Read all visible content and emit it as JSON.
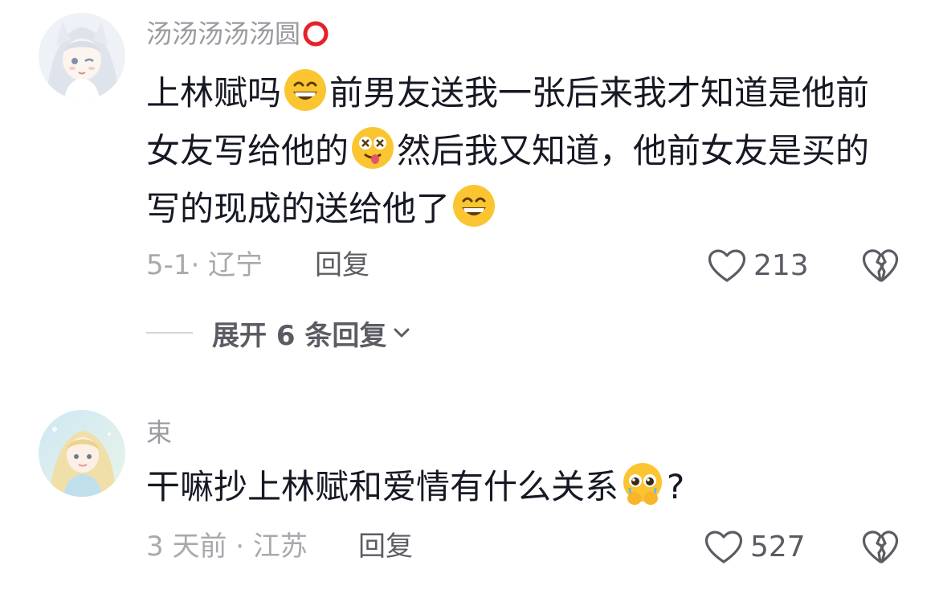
{
  "comments": [
    {
      "username": "汤汤汤汤汤圆",
      "username_emoji": "red-circle-icon",
      "text_segments": [
        "上林赋吗",
        "[grin]",
        "前男友送我一张后来我才知道是他前女友写给他的",
        "[dizzy]",
        "然后我又知道，他前女友是买的写的现成的送给他了",
        "[grin]"
      ],
      "text_1": "上林赋吗",
      "text_2": "前男友送我一张后来我才知道是他前女友写给他的",
      "text_3": "然后我又知道，他前女友是买的写的现成的送给他了",
      "date": "5-1",
      "location": "辽宁",
      "meta": "5-1· 辽宁",
      "reply_label": "回复",
      "like_count": "213",
      "expand_label": "展开 6 条回复"
    },
    {
      "username": "束",
      "text_1": "干嘛抄上林赋和爱情有什么关系",
      "text_2": "?",
      "meta": "3 天前 · 江苏",
      "reply_label": "回复",
      "like_count": "527"
    }
  ],
  "colors": {
    "primary_text": "#161823",
    "secondary_text": "#9a9ba0",
    "action_text": "#5b5c63",
    "emoji_yellow": "#fbc531"
  }
}
